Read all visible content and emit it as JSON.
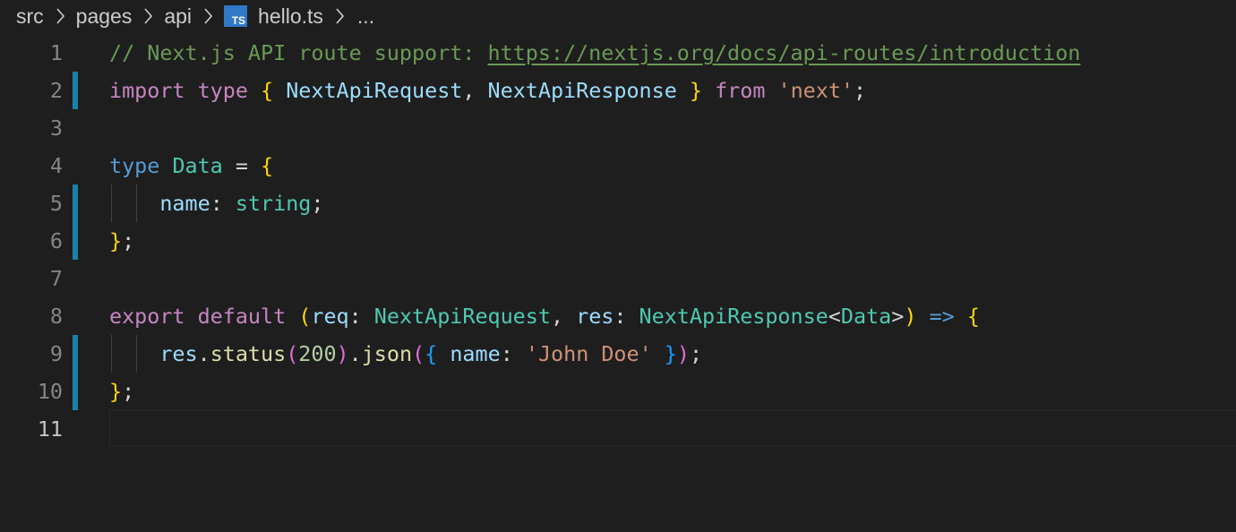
{
  "breadcrumb": {
    "items": [
      "src",
      "pages",
      "api"
    ],
    "file_icon_label": "TS",
    "file_name": "hello.ts",
    "ellipsis": "..."
  },
  "editor": {
    "language": "typescript",
    "active_line": "11",
    "lines": [
      {
        "num": "1",
        "modified": false,
        "tokens": [
          {
            "t": "// Next.js API route support: ",
            "c": "comment"
          },
          {
            "t": "https://nextjs.org/docs/api-routes/introduction",
            "c": "link"
          }
        ]
      },
      {
        "num": "2",
        "modified": true,
        "tokens": [
          {
            "t": "import",
            "c": "kw"
          },
          {
            "t": " ",
            "c": "punc"
          },
          {
            "t": "type",
            "c": "kw"
          },
          {
            "t": " ",
            "c": "punc"
          },
          {
            "t": "{",
            "c": "b1"
          },
          {
            "t": " ",
            "c": "punc"
          },
          {
            "t": "NextApiRequest",
            "c": "var"
          },
          {
            "t": ", ",
            "c": "punc"
          },
          {
            "t": "NextApiResponse",
            "c": "var"
          },
          {
            "t": " ",
            "c": "punc"
          },
          {
            "t": "}",
            "c": "b1"
          },
          {
            "t": " ",
            "c": "punc"
          },
          {
            "t": "from",
            "c": "kw"
          },
          {
            "t": " ",
            "c": "punc"
          },
          {
            "t": "'next'",
            "c": "str"
          },
          {
            "t": ";",
            "c": "punc"
          }
        ]
      },
      {
        "num": "3",
        "modified": false,
        "tokens": []
      },
      {
        "num": "4",
        "modified": false,
        "tokens": [
          {
            "t": "type",
            "c": "kwb"
          },
          {
            "t": " ",
            "c": "punc"
          },
          {
            "t": "Data",
            "c": "type"
          },
          {
            "t": " = ",
            "c": "punc"
          },
          {
            "t": "{",
            "c": "b1"
          }
        ]
      },
      {
        "num": "5",
        "modified": true,
        "indent": 1,
        "tokens": [
          {
            "t": "    ",
            "c": "punc"
          },
          {
            "t": "name",
            "c": "var"
          },
          {
            "t": ": ",
            "c": "punc"
          },
          {
            "t": "string",
            "c": "type"
          },
          {
            "t": ";",
            "c": "punc"
          }
        ]
      },
      {
        "num": "6",
        "modified": true,
        "tokens": [
          {
            "t": "}",
            "c": "b1"
          },
          {
            "t": ";",
            "c": "punc"
          }
        ]
      },
      {
        "num": "7",
        "modified": false,
        "tokens": []
      },
      {
        "num": "8",
        "modified": false,
        "tokens": [
          {
            "t": "export",
            "c": "kw"
          },
          {
            "t": " ",
            "c": "punc"
          },
          {
            "t": "default",
            "c": "kw"
          },
          {
            "t": " ",
            "c": "punc"
          },
          {
            "t": "(",
            "c": "b1"
          },
          {
            "t": "req",
            "c": "var"
          },
          {
            "t": ": ",
            "c": "punc"
          },
          {
            "t": "NextApiRequest",
            "c": "type"
          },
          {
            "t": ", ",
            "c": "punc"
          },
          {
            "t": "res",
            "c": "var"
          },
          {
            "t": ": ",
            "c": "punc"
          },
          {
            "t": "NextApiResponse",
            "c": "type"
          },
          {
            "t": "<",
            "c": "punc"
          },
          {
            "t": "Data",
            "c": "type"
          },
          {
            "t": ">",
            "c": "punc"
          },
          {
            "t": ")",
            "c": "b1"
          },
          {
            "t": " ",
            "c": "punc"
          },
          {
            "t": "=>",
            "c": "arrow"
          },
          {
            "t": " ",
            "c": "punc"
          },
          {
            "t": "{",
            "c": "b1"
          }
        ]
      },
      {
        "num": "9",
        "modified": true,
        "indent": 1,
        "tokens": [
          {
            "t": "    ",
            "c": "punc"
          },
          {
            "t": "res",
            "c": "var"
          },
          {
            "t": ".",
            "c": "punc"
          },
          {
            "t": "status",
            "c": "fn"
          },
          {
            "t": "(",
            "c": "b2"
          },
          {
            "t": "200",
            "c": "num"
          },
          {
            "t": ")",
            "c": "b2"
          },
          {
            "t": ".",
            "c": "punc"
          },
          {
            "t": "json",
            "c": "fn"
          },
          {
            "t": "(",
            "c": "b2"
          },
          {
            "t": "{",
            "c": "b3"
          },
          {
            "t": " ",
            "c": "punc"
          },
          {
            "t": "name",
            "c": "var"
          },
          {
            "t": ": ",
            "c": "punc"
          },
          {
            "t": "'John Doe'",
            "c": "str"
          },
          {
            "t": " ",
            "c": "punc"
          },
          {
            "t": "}",
            "c": "b3"
          },
          {
            "t": ")",
            "c": "b2"
          },
          {
            "t": ";",
            "c": "punc"
          }
        ]
      },
      {
        "num": "10",
        "modified": true,
        "tokens": [
          {
            "t": "}",
            "c": "b1"
          },
          {
            "t": ";",
            "c": "punc"
          }
        ]
      },
      {
        "num": "11",
        "modified": false,
        "tokens": []
      }
    ]
  }
}
